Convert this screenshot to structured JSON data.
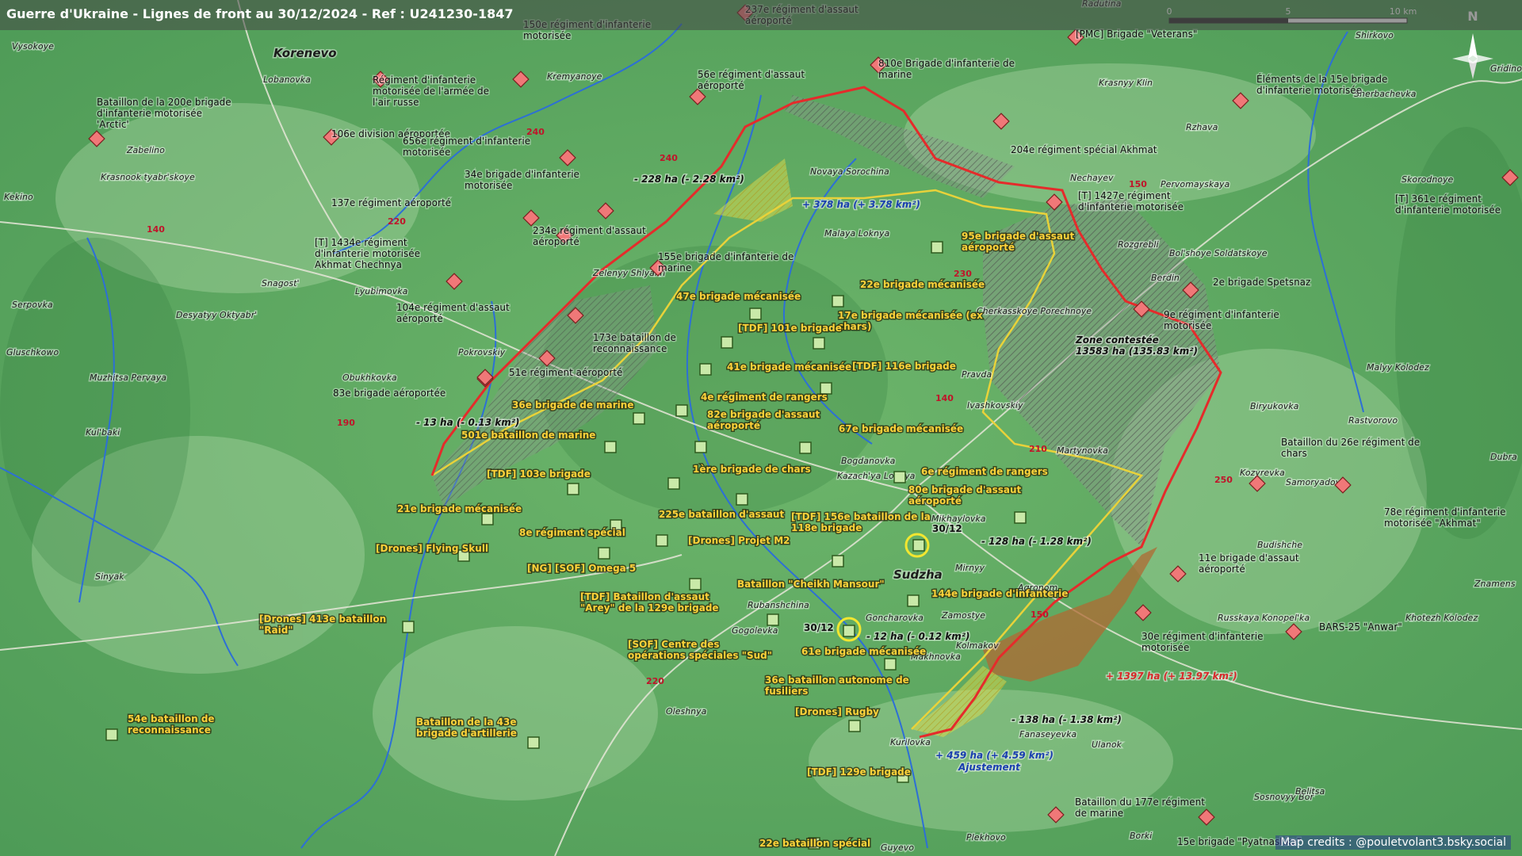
{
  "title": "Guerre d'Ukraine - Lignes de front au 30/12/2024 - Ref : U241230-1847",
  "credits": "Map credits : @pouletvolant3.bsky.social",
  "scale": {
    "t0": "0",
    "t5": "5",
    "t10": "10 km"
  },
  "north": "N",
  "colors": {
    "russian": "#f07878",
    "ukrainian_label": "#ffd23a",
    "front_line": "#e52b2b",
    "contested": "#9a9a9a",
    "russian_gain": "#b06a33",
    "ukrainian_gain": "#ffee44"
  },
  "places": [
    "Korenevo",
    "Lobanovka",
    "Vysokoye",
    "Kremyanoye",
    "Zabelino",
    "Krasnook tyabr'skoye",
    "Kekino",
    "Snagost'",
    "Lyubimovka",
    "Zelenyy Shlyakh",
    "Serpovka",
    "Desyatyy Oktyabr'",
    "Pokrovskiy",
    "Obukhkovka",
    "Gluschkowo",
    "Muzhitsa Pervaya",
    "Kul'baki",
    "Sinyak",
    "Novaya Sorochina",
    "Malaya Loknya",
    "Nechayev",
    "Pervomayskaya",
    "Skorodnoye",
    "Rozgrebli",
    "Berdin",
    "Bol'shoye Soldatskoye",
    "Cherkasskoye Porechnoye",
    "Pravda",
    "Ivashkovskiy",
    "Martynovka",
    "Bogdanovka",
    "Kazach'ya Loknya",
    "Mikhaylovka",
    "Sudzha",
    "Mirnyy",
    "Rubanshchina",
    "Goncharovka",
    "Zamostye",
    "Gogolevka",
    "Makhnovka",
    "Kolmakov",
    "Agronom",
    "Oleshnya",
    "Kurilovka",
    "Fanaseyevka",
    "Ulanok",
    "Plekhovo",
    "Guyevo",
    "Borki",
    "Sosnovyy Bor",
    "Belitsa",
    "Russkaya Konopel'ka",
    "Budishche",
    "Kozyrevka",
    "Samoryadovo",
    "Biryukovka",
    "Rastvorovo",
    "Malyy Kolodez",
    "Khotezh Kolodez",
    "Znamens",
    "Dubra",
    "Shirkovo",
    "Sherbachevka",
    "Krasnyy Klin",
    "Rzhava",
    "Radutina",
    "Gridino"
  ],
  "roads": [
    "240",
    "240",
    "220",
    "140",
    "230",
    "140",
    "190",
    "210",
    "250",
    "150",
    "150",
    "220"
  ],
  "russian_units": [
    "237e régiment d'assaut aéroporté",
    "150e régiment d'infanterie motorisée",
    "Régiment d'infanterie motorisée de l'armée de l'air russe",
    "56e régiment d'assaut aéroporté",
    "810e Brigade d'infanterie de marine",
    "[PMC] Brigade \"Veterans\"",
    "Bataillon de la 200e brigade d'infanterie motorisée 'Arctic'",
    "106e division aéroportée",
    "656e régiment d'infanterie motorisée",
    "34e brigade d'infanterie motorisée",
    "137e régiment aéroporté",
    "234e régiment d'assaut aéroporté",
    "[T] 1434e régiment d'infanterie motorisée Akhmat Chechnya",
    "155e brigade d'infanterie de marine",
    "104e régiment d'assaut aéroporté",
    "173e bataillon de reconnaissance",
    "51e régiment aéroporté",
    "83e brigade aéroportée",
    "204e régiment spécial Akhmat",
    "[T] 1427e régiment d'infanterie motorisée",
    "2e brigade Spetsnaz",
    "9e régiment d'infanterie motorisée",
    "Éléments de la 15e brigade d'infanterie motorisée",
    "[T] 361e régiment d'infanterie motorisée",
    "Bataillon du 26e régiment de chars",
    "78e régiment d'infanterie motorisée \"Akhmat\"",
    "11e brigade d'assaut aéroporté",
    "30e régiment d'infanterie motorisée",
    "BARS-25 \"Anwar\"",
    "Bataillon du 177e régiment de marine",
    "15e brigade \"Pyatnashka\""
  ],
  "ukrainian_units": [
    "47e brigade mécanisée",
    "22e brigade mécanisée",
    "17e brigade mécanisée (ex chars)",
    "95e brigade d'assaut aéroporté",
    "[TDF] 101e brigade",
    "41e brigade mécanisée",
    "[TDF] 116e brigade",
    "4e régiment de rangers",
    "36e brigade de marine",
    "82e brigade d'assaut aéroporté",
    "67e brigade mécanisée",
    "501e bataillon de marine",
    "[TDF] 103e brigade",
    "1ère brigade de chars",
    "6e régiment de rangers",
    "80e brigade d'assaut aéroporté",
    "21e brigade mécanisée",
    "8e régiment spécial",
    "225e bataillon d'assaut",
    "[TDF] 156e bataillon de la 118e brigade",
    "[Drones] Flying Skull",
    "[Drones] Projet M2",
    "[NG] [SOF] Omega 5",
    "Bataillon \"Cheikh Mansour\"",
    "144e brigade d'infanterie",
    "[TDF] Bataillon d'assaut \"Arey\" de la 129e brigade",
    "[Drones] 413e bataillon \"Raid\"",
    "[SOF] Centre des opérations spéciales \"Sud\"",
    "61e brigade mécanisée",
    "36e bataillon autonome de fusiliers",
    "[Drones] Rugby",
    "54e bataillon de reconnaissance",
    "Bataillon de la 43e brigade d'artillerie",
    "[TDF] 129e brigade",
    "22e bataillon spécial"
  ],
  "annotations": [
    "- 228 ha (- 2.28 km²)",
    "+ 378 ha (+ 3.78 km²)",
    "- 13 ha (- 0.13 km²)",
    "Zone contestée 13583 ha (135.83 km²)",
    "- 128 ha (- 1.28 km²)",
    "- 12 ha (- 0.12 km²)",
    "+ 1397 ha (+ 13.97 km²)",
    "- 138 ha (- 1.38 km²)",
    "+ 459 ha (+ 4.59 km²)",
    "Ajustement",
    "30/12",
    "30/12"
  ]
}
